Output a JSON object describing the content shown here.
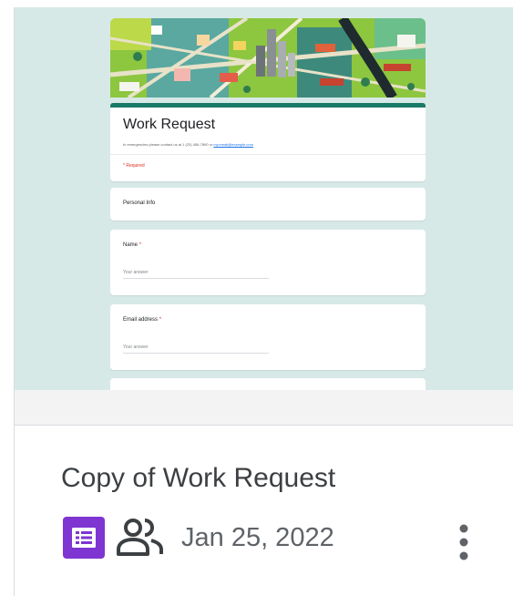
{
  "preview": {
    "title": "Work Request",
    "description": "In emergencies please contact us at 1 (23) 456-7890 or ",
    "description_link": "my.email@example.com",
    "required_note": "* Required",
    "section_title": "Personal Info",
    "questions": [
      {
        "label": "Name",
        "required_mark": "*",
        "placeholder": "Your answer"
      },
      {
        "label": "Email address",
        "required_mark": "*",
        "placeholder": "Your answer"
      }
    ],
    "accent_color": "#1a7a68",
    "banner_art": "city-map-illustration"
  },
  "file": {
    "title": "Copy of Work Request",
    "type_icon": "google-forms-icon",
    "type_icon_color": "#7e35d2",
    "shared_icon": "people-icon",
    "date": "Jan 25, 2022",
    "menu_icon": "more-vert-icon"
  }
}
